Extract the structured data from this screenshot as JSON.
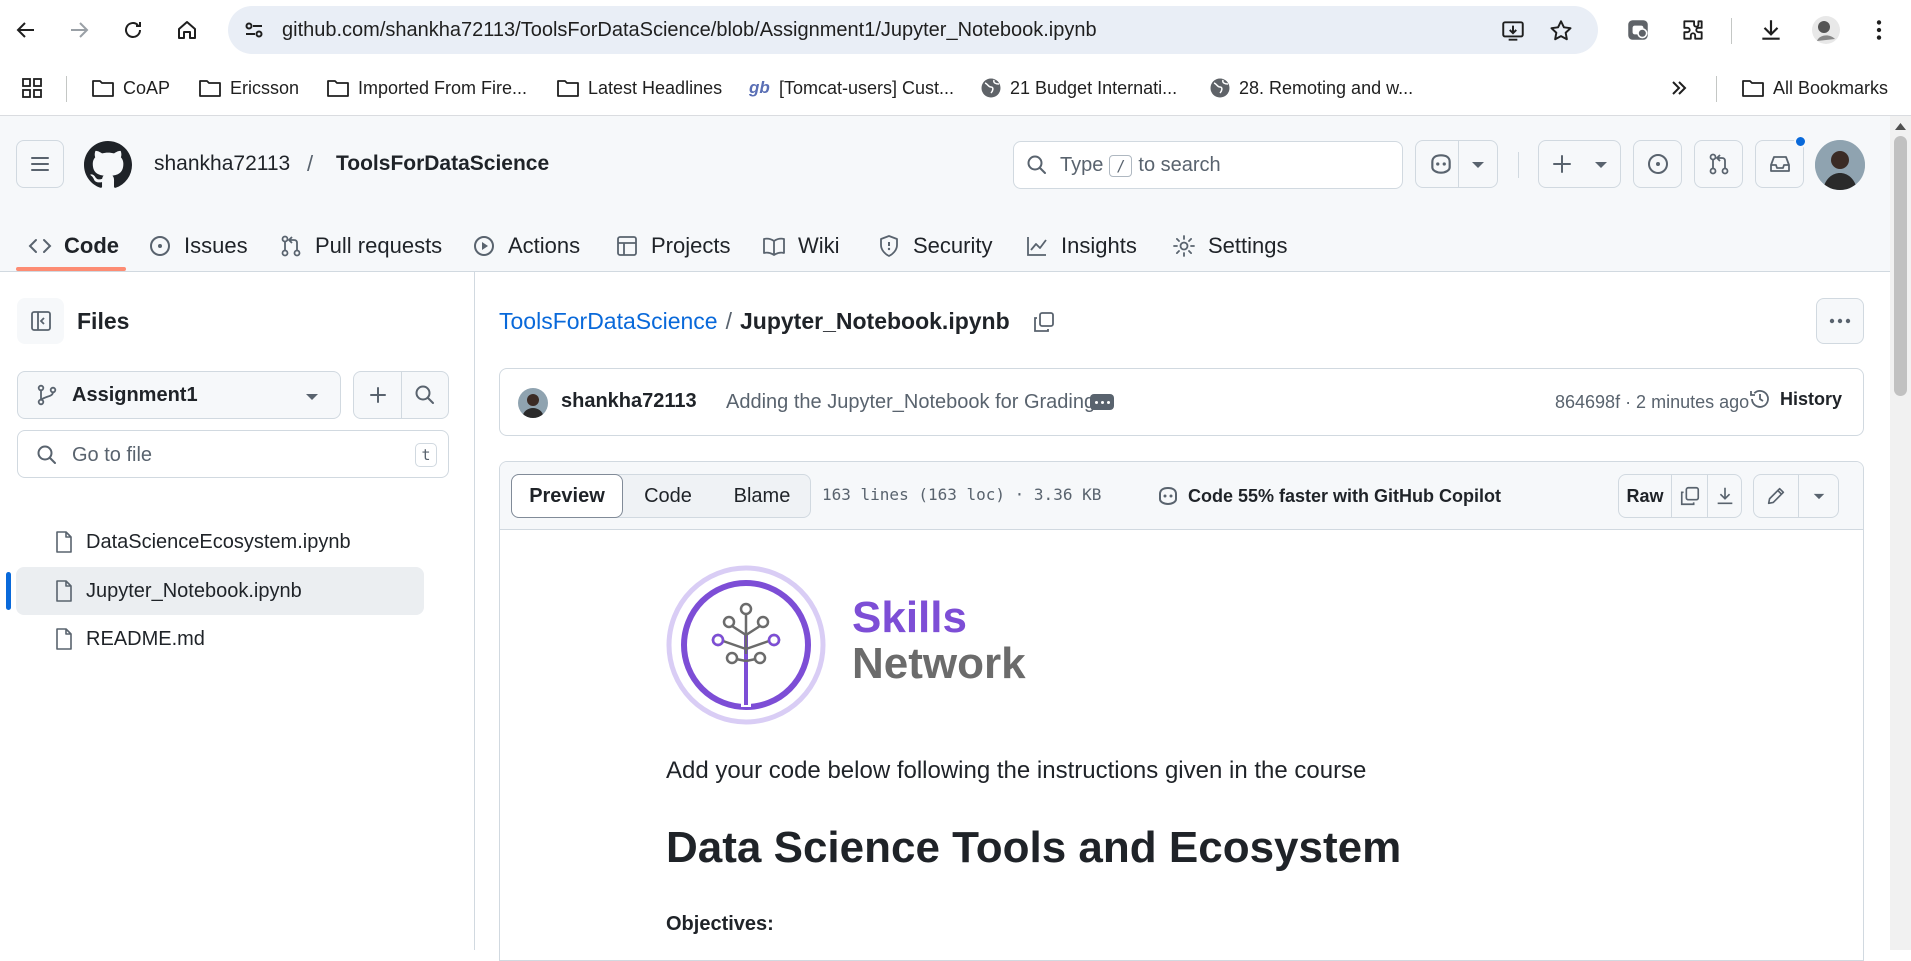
{
  "browser": {
    "url": "github.com/shankha72113/ToolsForDataScience/blob/Assignment1/Jupyter_Notebook.ipynb",
    "bookmarks": [
      {
        "label": "CoAP",
        "icon": "folder-icon"
      },
      {
        "label": "Ericsson",
        "icon": "folder-icon"
      },
      {
        "label": "Imported From Fire...",
        "icon": "folder-icon"
      },
      {
        "label": "Latest Headlines",
        "icon": "folder-icon"
      },
      {
        "label": "[Tomcat-users] Cust...",
        "icon": "gb-icon"
      },
      {
        "label": "21 Budget Internati...",
        "icon": "globe-icon"
      },
      {
        "label": "28. Remoting and w...",
        "icon": "globe-icon"
      }
    ],
    "all_bookmarks": "All Bookmarks"
  },
  "header": {
    "owner": "shankha72113",
    "separator": "/",
    "repo": "ToolsForDataScience",
    "search_prefix": "Type",
    "search_key": "/",
    "search_suffix": "to search"
  },
  "tabs": [
    {
      "label": "Code",
      "icon": "code-icon"
    },
    {
      "label": "Issues",
      "icon": "issue-icon"
    },
    {
      "label": "Pull requests",
      "icon": "pull-request-icon"
    },
    {
      "label": "Actions",
      "icon": "play-icon"
    },
    {
      "label": "Projects",
      "icon": "table-icon"
    },
    {
      "label": "Wiki",
      "icon": "book-icon"
    },
    {
      "label": "Security",
      "icon": "shield-icon"
    },
    {
      "label": "Insights",
      "icon": "graph-icon"
    },
    {
      "label": "Settings",
      "icon": "gear-icon"
    }
  ],
  "sidebar": {
    "title": "Files",
    "branch": "Assignment1",
    "goto_placeholder": "Go to file",
    "goto_key": "t",
    "files": [
      {
        "name": "DataScienceEcosystem.ipynb",
        "selected": false
      },
      {
        "name": "Jupyter_Notebook.ipynb",
        "selected": true
      },
      {
        "name": "README.md",
        "selected": false
      }
    ]
  },
  "file": {
    "repo_link": "ToolsForDataScience",
    "sep": "/",
    "name": "Jupyter_Notebook.ipynb",
    "commit": {
      "author": "shankha72113",
      "message": "Adding the Jupyter_Notebook for Grading",
      "meta": "864698f · 2 minutes ago",
      "history": "History"
    },
    "toolbar": {
      "preview": "Preview",
      "code": "Code",
      "blame": "Blame",
      "stats": "163 lines (163 loc) · 3.36 KB",
      "copilot": "Code 55% faster with GitHub Copilot",
      "raw": "Raw"
    }
  },
  "notebook": {
    "logo_line1": "Skills",
    "logo_line2": "Network",
    "instruction": "Add your code below following the instructions given in the course",
    "heading": "Data Science Tools and Ecosystem",
    "objectives": "Objectives:"
  },
  "colors": {
    "accent_link": "#0969da",
    "tab_underline": "#fd8c73",
    "logo_purple": "#7d4ed6",
    "logo_gray": "#6b6b6b"
  }
}
